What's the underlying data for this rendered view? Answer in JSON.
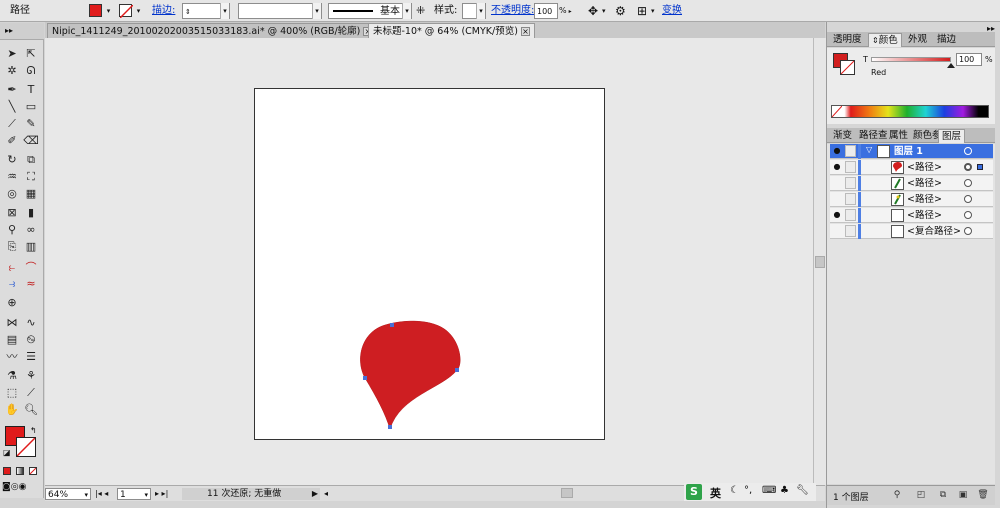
{
  "control_bar": {
    "object_type": "路径",
    "fill_color": "#e01b1b",
    "stroke_label": "描边:",
    "stroke_weight": "",
    "brush_preset": "",
    "stroke_profile": "基本",
    "style_label": "样式:",
    "opacity_label": "不透明度:",
    "opacity_value": "100",
    "opacity_unit": "%",
    "transform_link": "变换"
  },
  "document_tabs": [
    {
      "title": "Nipic_1411249_20100202003515033183.ai* @ 400% (RGB/轮廓)",
      "active": false
    },
    {
      "title": "未标题-10* @ 64% (CMYK/预览)",
      "active": true
    }
  ],
  "status_bar": {
    "zoom": "64%",
    "artboard": "1",
    "history": "11 次还原; 无重做"
  },
  "color_panel": {
    "tabs": [
      "透明度",
      "颜色",
      "外观",
      "描边"
    ],
    "active_tab": "颜色",
    "channel_label": "T",
    "channel_value": "100",
    "channel_unit": "%",
    "color_name": "Red",
    "current_color": "#d21e1e"
  },
  "layers_panel": {
    "tabs": [
      "渐变",
      "路径查",
      "属性",
      "颜色参",
      "图层"
    ],
    "active_tab": "图层",
    "rows": [
      {
        "name": "图层 1",
        "is_layer": true,
        "visible": true,
        "selected": false
      },
      {
        "name": "<路径>",
        "is_layer": false,
        "visible": true,
        "selected": true
      },
      {
        "name": "<路径>",
        "is_layer": false,
        "visible": false,
        "selected": false
      },
      {
        "name": "<路径>",
        "is_layer": false,
        "visible": false,
        "selected": false
      },
      {
        "name": "<路径>",
        "is_layer": false,
        "visible": true,
        "selected": false
      },
      {
        "name": "<复合路径>",
        "is_layer": false,
        "visible": false,
        "selected": false
      }
    ],
    "footer_count": "1 个图层"
  },
  "ime": {
    "mode": "英"
  },
  "drawing": {
    "fill": "#ce1e22",
    "anchor_color": "#4a6fd6"
  }
}
